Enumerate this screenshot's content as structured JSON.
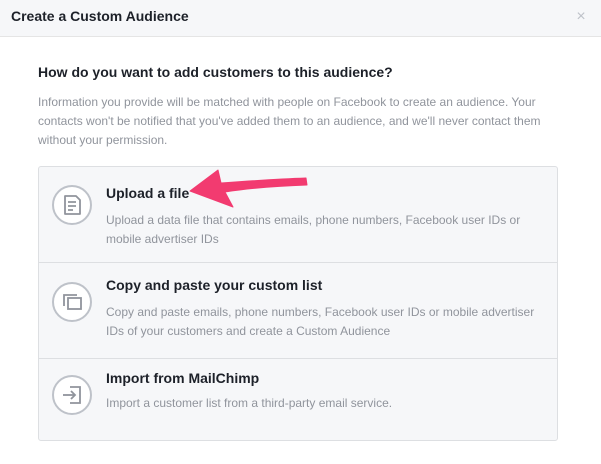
{
  "dialog": {
    "title": "Create a Custom Audience",
    "close_icon": "close-icon",
    "question": "How do you want to add customers to this audience?",
    "info": "Information you provide will be matched with people on Facebook to create an audience. Your contacts won't be notified that you've added them to an audience, and we'll never contact them without your permission."
  },
  "options": [
    {
      "title": "Upload a file",
      "description": "Upload a data file that contains emails, phone numbers, Facebook user IDs or mobile advertiser IDs",
      "icon": "document-icon"
    },
    {
      "title": "Copy and paste your custom list",
      "description": "Copy and paste emails, phone numbers, Facebook user IDs or mobile advertiser IDs of your customers and create a Custom Audience",
      "icon": "copy-icon"
    },
    {
      "title": "Import from MailChimp",
      "description": "Import a customer list from a third-party email service.",
      "icon": "import-icon"
    }
  ],
  "annotation": {
    "arrow_color": "#f23b70"
  }
}
